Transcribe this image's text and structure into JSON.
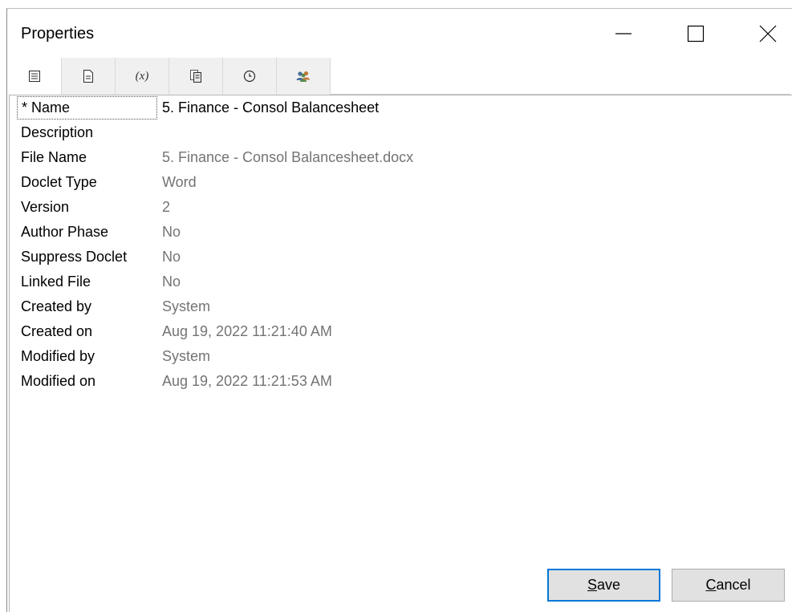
{
  "window": {
    "title": "Properties"
  },
  "tabs": [
    {
      "name": "list-icon",
      "active": true
    },
    {
      "name": "document-icon",
      "active": false
    },
    {
      "name": "variable-icon",
      "label": "(x)",
      "active": false
    },
    {
      "name": "pages-icon",
      "active": false
    },
    {
      "name": "clock-icon",
      "active": false
    },
    {
      "name": "users-icon",
      "active": false
    }
  ],
  "properties": [
    {
      "label": "* Name",
      "value": "5. Finance - Consol Balancesheet"
    },
    {
      "label": "Description",
      "value": ""
    },
    {
      "label": "File Name",
      "value": "5. Finance - Consol Balancesheet.docx"
    },
    {
      "label": "Doclet Type",
      "value": "Word"
    },
    {
      "label": "Version",
      "value": "2"
    },
    {
      "label": "Author Phase",
      "value": "No"
    },
    {
      "label": "Suppress Doclet",
      "value": "No"
    },
    {
      "label": "Linked File",
      "value": "No"
    },
    {
      "label": "Created by",
      "value": "System"
    },
    {
      "label": "Created on",
      "value": "Aug 19, 2022 11:21:40 AM"
    },
    {
      "label": "Modified by",
      "value": "System"
    },
    {
      "label": "Modified on",
      "value": "Aug 19, 2022 11:21:53 AM"
    }
  ],
  "buttons": {
    "save_mnemonic": "S",
    "save_rest": "ave",
    "cancel_mnemonic": "C",
    "cancel_rest": "ancel"
  },
  "colors": {
    "accent": "#0078d7",
    "value_text": "#737373",
    "button_bg": "#e1e1e1",
    "tab_bg": "#f0f0f0"
  }
}
